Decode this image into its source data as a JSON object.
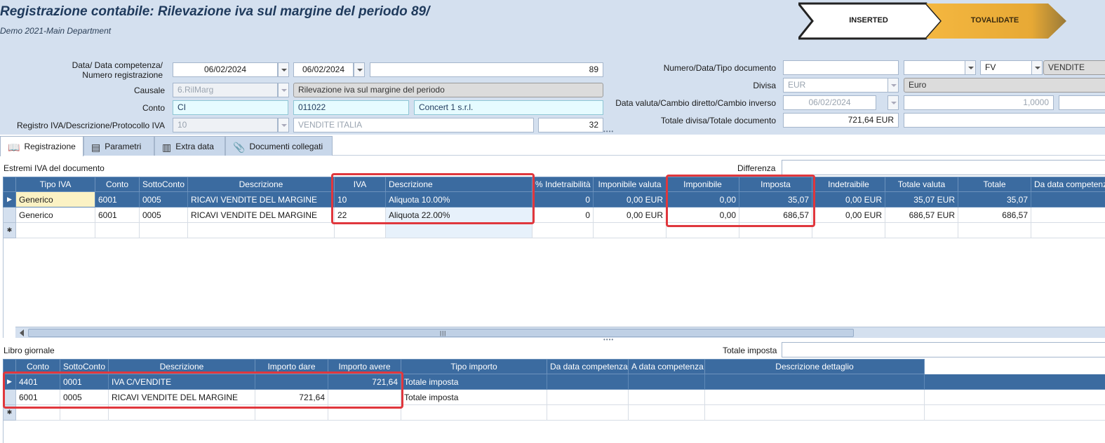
{
  "header": {
    "title": "Registrazione contabile: Rilevazione iva sul margine del periodo 89/",
    "subtitle": "Demo 2021-Main Department",
    "status": {
      "inserted": "INSERTED",
      "tovalidate": "TOVALIDATE",
      "inserted_color": "#ffffff",
      "tovalidate_color": "#f2b33d"
    }
  },
  "form": {
    "data_label": "Data/ Data competenza/\nNumero registrazione",
    "data": "06/02/2024",
    "data_competenza": "06/02/2024",
    "numero_registrazione": "89",
    "causale_label": "Causale",
    "causale_code": "6.RilMarg",
    "causale_desc": "Rilevazione iva sul margine del periodo",
    "conto_label": "Conto",
    "conto_code": "CI",
    "conto_num": "011022",
    "conto_desc": "Concert 1 s.r.l.",
    "registro_label": "Registro IVA/Descrizione/Protocollo IVA",
    "registro_code": "10",
    "registro_desc": "VENDITE ITALIA",
    "protocollo": "32",
    "numdoc_label": "Numero/Data/Tipo documento",
    "numero_documento": "",
    "data_documento": "",
    "tipo_documento": "FV",
    "tipo_documento_desc": "VENDITE",
    "divisa_label": "Divisa",
    "divisa_code": "EUR",
    "divisa_desc": "Euro",
    "valuta_label": "Data valuta/Cambio diretto/Cambio inverso",
    "data_valuta": "06/02/2024",
    "cambio_diretto": "1,0000",
    "cambio_inverso": "",
    "totale_label": "Totale divisa/Totale documento",
    "totale_divisa": "721,64 EUR",
    "totale_documento": ""
  },
  "tabs": [
    {
      "label": "Registrazione",
      "icon": "book-icon"
    },
    {
      "label": "Parametri",
      "icon": "parameters-icon"
    },
    {
      "label": "Extra data",
      "icon": "extra-data-icon"
    },
    {
      "label": "Documenti collegati",
      "icon": "paperclip-icon"
    }
  ],
  "iva_section": {
    "label": "Estremi IVA del documento",
    "differenza_label": "Differenza",
    "differenza_value": "",
    "columns": [
      "Tipo IVA",
      "Conto",
      "SottoConto",
      "Descrizione",
      "IVA",
      "Descrizione",
      "% Indetraibilità",
      "Imponibile valuta",
      "Imponibile",
      "Imposta",
      "Indetraibile",
      "Totale valuta",
      "Totale",
      "Da data competenza"
    ],
    "rows": [
      [
        "Generico",
        "6001",
        "0005",
        "RICAVI VENDITE DEL MARGINE",
        "10",
        "Aliquota 10.00%",
        "0",
        "0,00 EUR",
        "0,00",
        "35,07",
        "0,00 EUR",
        "35,07 EUR",
        "35,07",
        ""
      ],
      [
        "Generico",
        "6001",
        "0005",
        "RICAVI VENDITE DEL MARGINE",
        "22",
        "Aliquota 22.00%",
        "0",
        "0,00 EUR",
        "0,00",
        "686,57",
        "0,00 EUR",
        "686,57 EUR",
        "686,57",
        ""
      ]
    ]
  },
  "giornale_section": {
    "label": "Libro giornale",
    "totale_imposta_label": "Totale imposta",
    "totale_imposta_value": "",
    "columns": [
      "Conto",
      "SottoConto",
      "Descrizione",
      "Importo dare",
      "Importo avere",
      "Tipo importo",
      "Da data competenza",
      "A data competenza",
      "Descrizione dettaglio"
    ],
    "rows": [
      [
        "4401",
        "0001",
        "IVA C/VENDITE",
        "",
        "721,64",
        "Totale imposta",
        "",
        "",
        ""
      ],
      [
        "6001",
        "0005",
        "RICAVI VENDITE DEL MARGINE",
        "721,64",
        "",
        "Totale imposta",
        "",
        "",
        ""
      ]
    ]
  },
  "colors": {
    "header_bg": "#d4e0ef",
    "grid_header": "#3b6ba0",
    "highlight_border": "#e0373d",
    "field_cyan": "#e6fbff"
  }
}
